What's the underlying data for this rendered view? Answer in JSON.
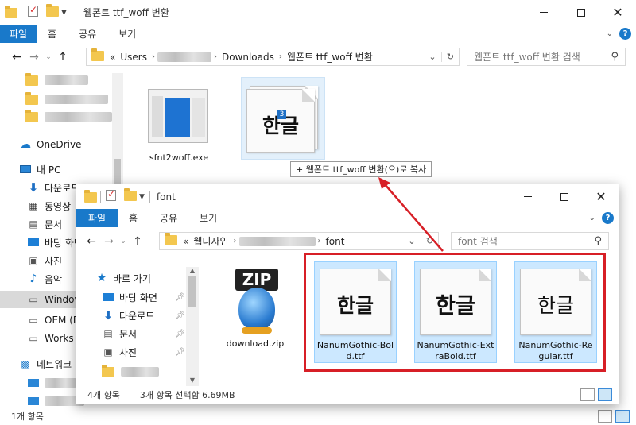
{
  "back_window": {
    "title": "웹폰트 ttf_woff 변환",
    "ribbon": {
      "file": "파일",
      "tabs": [
        "홈",
        "공유",
        "보기"
      ]
    },
    "address": {
      "prefix": "«",
      "crumbs": [
        "Users",
        "Downloads",
        "웹폰트 ttf_woff 변환"
      ]
    },
    "search_placeholder": "웹폰트 ttf_woff 변환 검색",
    "sidebar": {
      "onedrive": "OneDrive",
      "this_pc": "내 PC",
      "items": [
        "다운로드",
        "동영상",
        "문서",
        "바탕 화면",
        "사진",
        "음악",
        "Windows",
        "OEM (D",
        "Works ("
      ],
      "network": "네트워크"
    },
    "files": [
      {
        "name": "sfnt2woff.exe"
      },
      {
        "name": "",
        "glyph": "한글",
        "badge": "3"
      }
    ],
    "drag_tooltip": "+ 웹폰트 ttf_woff 변환(으)로 복사",
    "status": "1개 항목"
  },
  "front_window": {
    "title": "font",
    "ribbon": {
      "file": "파일",
      "tabs": [
        "홈",
        "공유",
        "보기"
      ]
    },
    "address": {
      "prefix": "«",
      "crumbs": [
        "웹디자인",
        "font"
      ]
    },
    "search_placeholder": "font 검색",
    "sidebar": {
      "quick_access": "바로 가기",
      "items": [
        "바탕 화면",
        "다운로드",
        "문서",
        "사진"
      ]
    },
    "files": [
      {
        "name": "download.zip",
        "badge": "ZIP"
      },
      {
        "name": "NanumGothic-Bold.ttf",
        "glyph": "한글",
        "weight": "bold"
      },
      {
        "name": "NanumGothic-ExtraBold.ttf",
        "glyph": "한글",
        "weight": "extrabold"
      },
      {
        "name": "NanumGothic-Regular.ttf",
        "glyph": "한글",
        "weight": "regular"
      }
    ],
    "status": {
      "count": "4개 항목",
      "selection": "3개 항목 선택함 6.69MB"
    }
  },
  "colors": {
    "accent": "#1979ca",
    "highlight": "#d71f26",
    "selection": "#cce8ff"
  }
}
